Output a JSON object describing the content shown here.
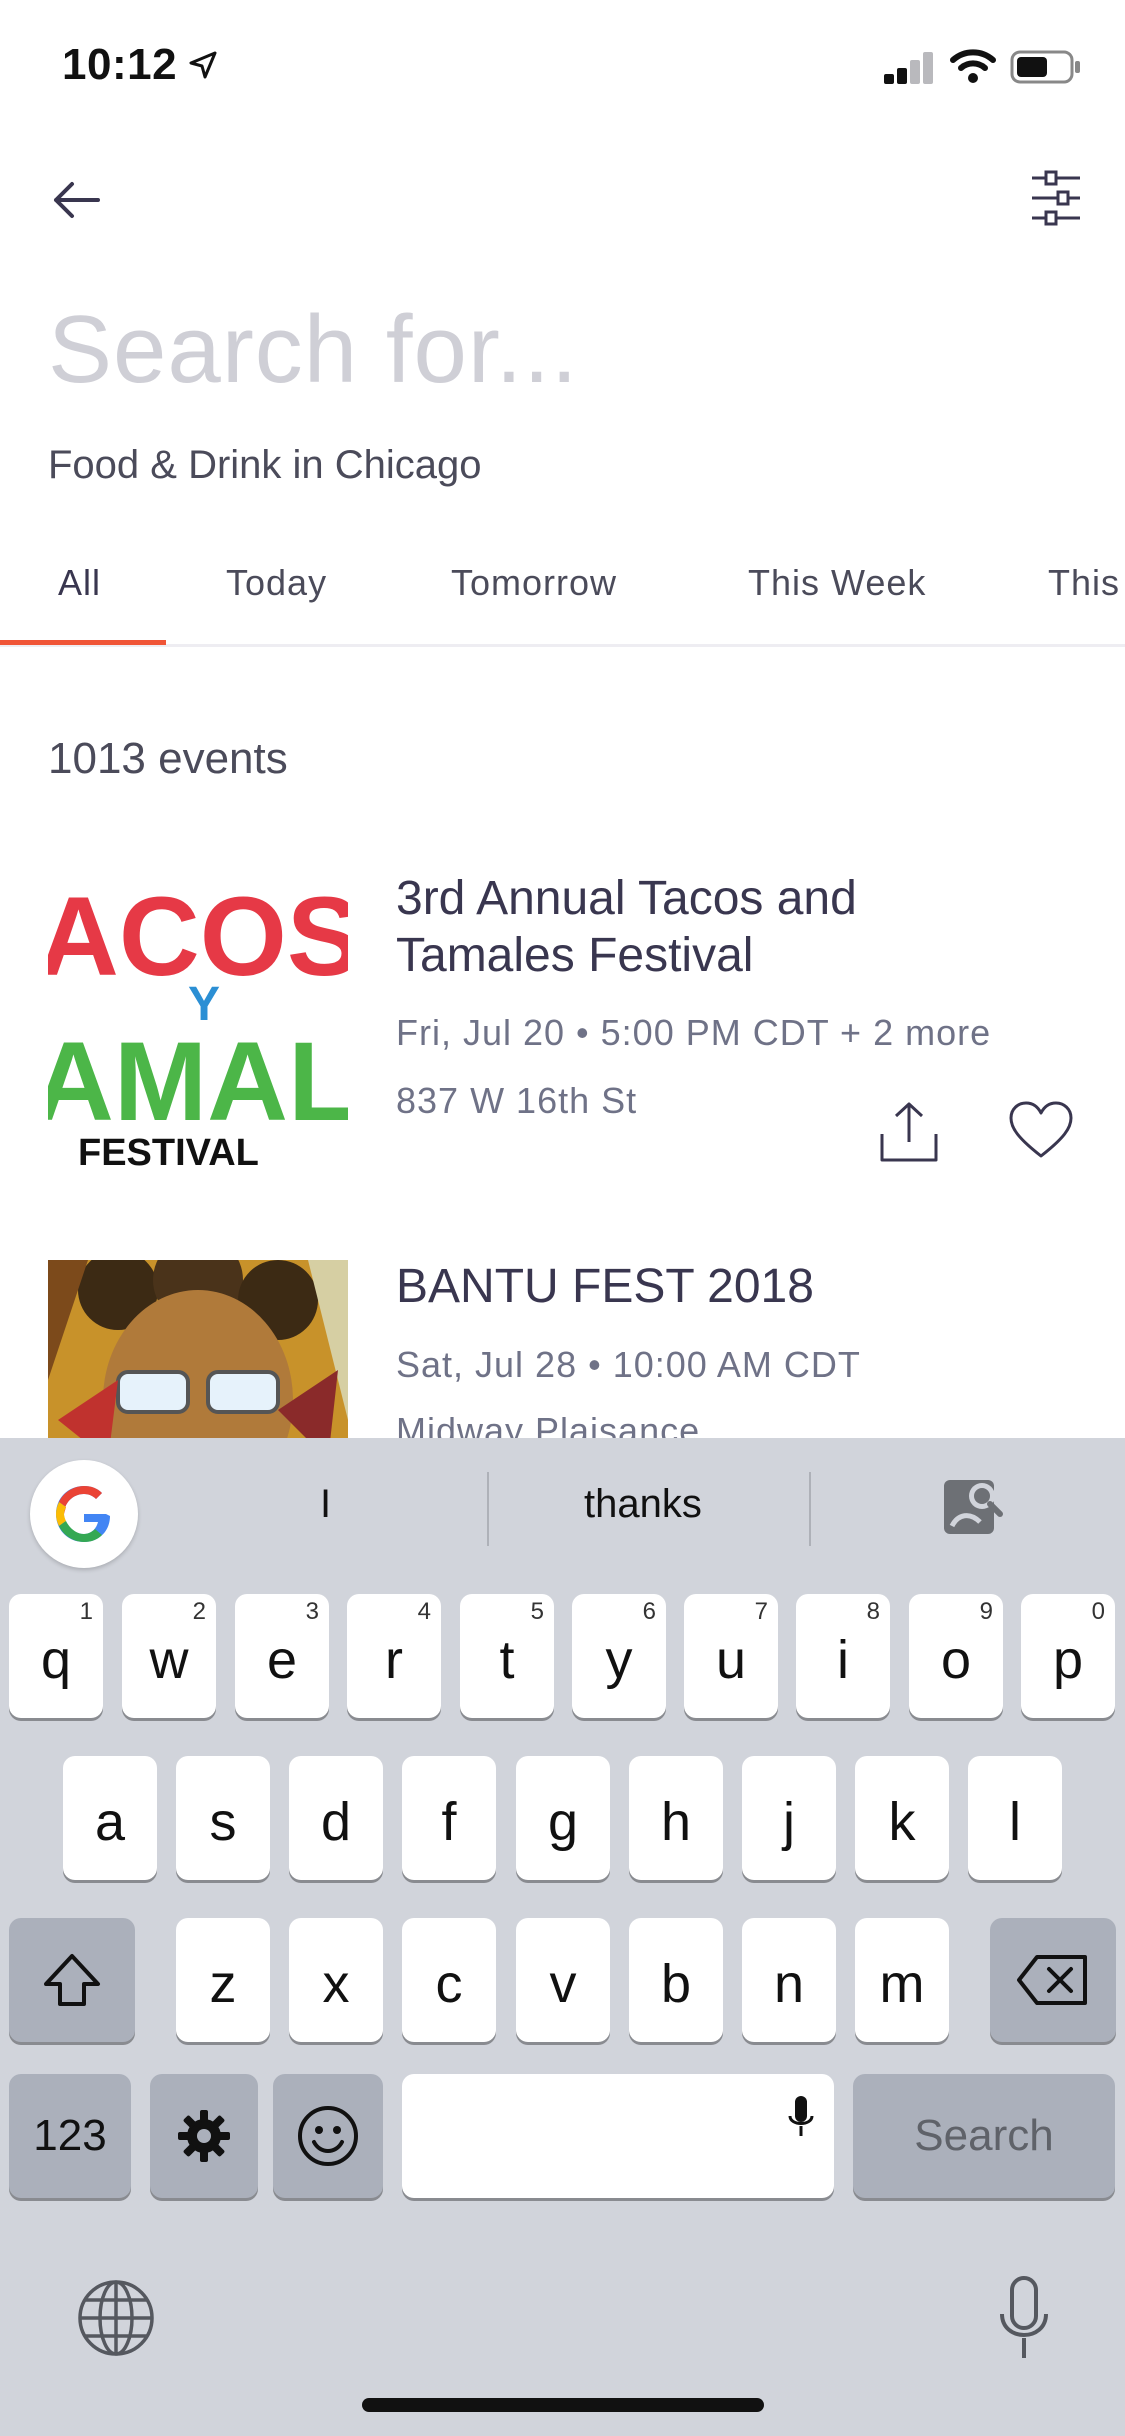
{
  "status_bar": {
    "time": "10:12"
  },
  "search": {
    "placeholder": "Search for...",
    "subtitle": "Food & Drink in Chicago"
  },
  "tabs": [
    {
      "label": "All",
      "active": true
    },
    {
      "label": "Today"
    },
    {
      "label": "Tomorrow"
    },
    {
      "label": "This Week"
    },
    {
      "label": "This"
    }
  ],
  "results": {
    "count_label": "1013 events",
    "events": [
      {
        "title_line1": "3rd Annual Tacos and",
        "title_line2": "Tamales Festival",
        "date": "Fri, Jul 20 • 5:00 PM CDT + 2 more",
        "location": "837 W 16th St",
        "thumb_text": {
          "top": "ACOS",
          "middle": "Y",
          "bottom": "AMAL",
          "footer": "FESTIVAL"
        }
      },
      {
        "title": "BANTU FEST 2018",
        "date": "Sat, Jul 28 • 10:00 AM CDT",
        "location": "Midway Plaisance"
      }
    ]
  },
  "keyboard": {
    "suggestions": [
      "I",
      "thanks"
    ],
    "row1": [
      {
        "k": "q",
        "h": "1"
      },
      {
        "k": "w",
        "h": "2"
      },
      {
        "k": "e",
        "h": "3"
      },
      {
        "k": "r",
        "h": "4"
      },
      {
        "k": "t",
        "h": "5"
      },
      {
        "k": "y",
        "h": "6"
      },
      {
        "k": "u",
        "h": "7"
      },
      {
        "k": "i",
        "h": "8"
      },
      {
        "k": "o",
        "h": "9"
      },
      {
        "k": "p",
        "h": "0"
      }
    ],
    "row2": [
      "a",
      "s",
      "d",
      "f",
      "g",
      "h",
      "j",
      "k",
      "l"
    ],
    "row3": [
      "z",
      "x",
      "c",
      "v",
      "b",
      "n",
      "m"
    ],
    "num_key": "123",
    "search_key": "Search"
  },
  "colors": {
    "accent": "#f05537",
    "text": "#39364f",
    "muted": "#6f7287",
    "keyboard_bg": "#d1d4db"
  }
}
